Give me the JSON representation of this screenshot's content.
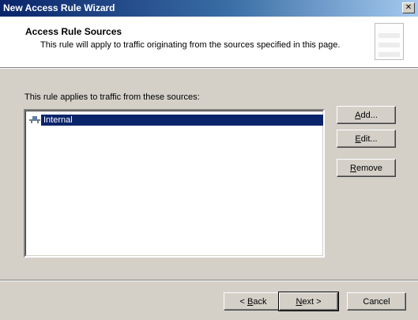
{
  "window": {
    "title": "New Access Rule Wizard",
    "close_glyph": "✕"
  },
  "header": {
    "title": "Access Rule Sources",
    "description": "This rule will apply to traffic originating from the sources specified in this page."
  },
  "main": {
    "prompt": "This rule applies to traffic from these sources:",
    "sources": [
      {
        "label": "Internal",
        "icon": "network-icon",
        "selected": true
      }
    ],
    "buttons": {
      "add": {
        "mnemonic": "A",
        "rest": "dd..."
      },
      "edit": {
        "mnemonic": "E",
        "rest": "dit..."
      },
      "remove": {
        "mnemonic": "R",
        "rest": "emove"
      }
    }
  },
  "footer": {
    "back": {
      "prefix": "< ",
      "mnemonic": "B",
      "rest": "ack"
    },
    "next": {
      "mnemonic": "N",
      "rest": "ext >"
    },
    "cancel": "Cancel"
  },
  "colors": {
    "title_bar": "#0a246a",
    "selection": "#0a246a",
    "face": "#d4d0c8"
  }
}
